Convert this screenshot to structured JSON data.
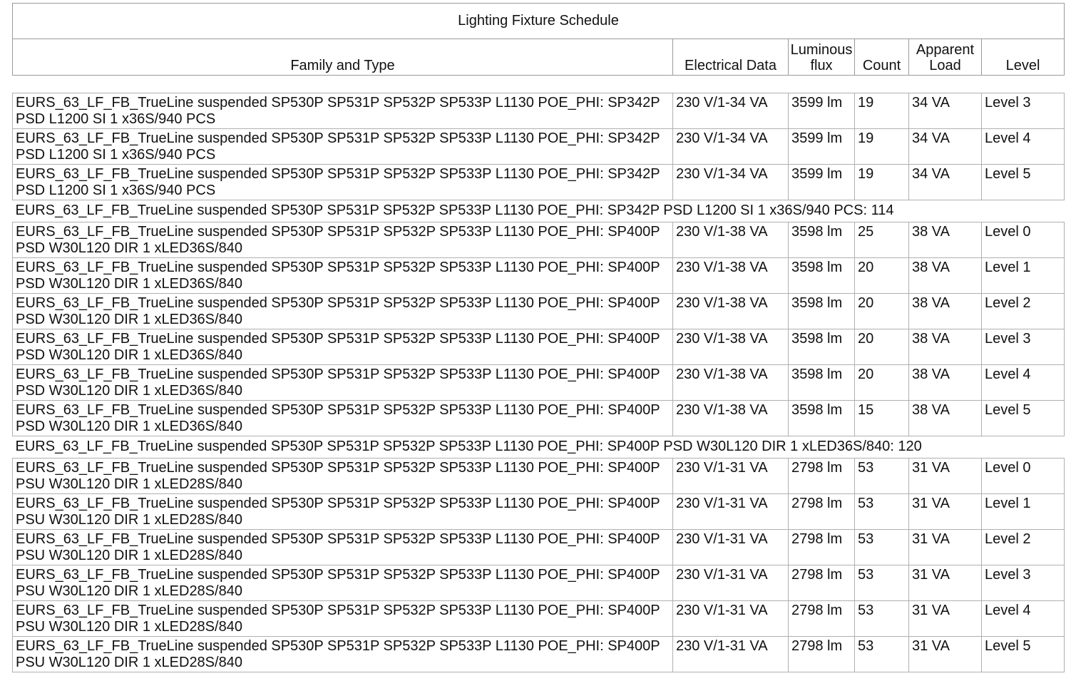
{
  "schedule": {
    "title": "Lighting Fixture Schedule",
    "columns": [
      "Family and Type",
      "Electrical Data",
      "Luminous flux",
      "Count",
      "Apparent Load",
      "Level"
    ],
    "groups": [
      {
        "rows": [
          {
            "family": "EURS_63_LF_FB_TrueLine suspended SP530P SP531P SP532P SP533P L1130 POE_PHI: SP342P PSD L1200 SI 1 x36S/940 PCS",
            "electrical": "230 V/1-34 VA",
            "flux": "3599 lm",
            "count": "19",
            "load": "34 VA",
            "level": "Level 3"
          },
          {
            "family": "EURS_63_LF_FB_TrueLine suspended SP530P SP531P SP532P SP533P L1130 POE_PHI: SP342P PSD L1200 SI 1 x36S/940 PCS",
            "electrical": "230 V/1-34 VA",
            "flux": "3599 lm",
            "count": "19",
            "load": "34 VA",
            "level": "Level 4"
          },
          {
            "family": "EURS_63_LF_FB_TrueLine suspended SP530P SP531P SP532P SP533P L1130 POE_PHI: SP342P PSD L1200 SI 1 x36S/940 PCS",
            "electrical": "230 V/1-34 VA",
            "flux": "3599 lm",
            "count": "19",
            "load": "34 VA",
            "level": "Level 5"
          }
        ],
        "subtotal": "EURS_63_LF_FB_TrueLine suspended SP530P SP531P SP532P SP533P L1130 POE_PHI: SP342P PSD L1200 SI 1 x36S/940 PCS: 114"
      },
      {
        "rows": [
          {
            "family": "EURS_63_LF_FB_TrueLine suspended SP530P SP531P SP532P SP533P L1130 POE_PHI: SP400P PSD W30L120 DIR 1 xLED36S/840",
            "electrical": "230 V/1-38 VA",
            "flux": "3598 lm",
            "count": "25",
            "load": "38 VA",
            "level": "Level 0"
          },
          {
            "family": "EURS_63_LF_FB_TrueLine suspended SP530P SP531P SP532P SP533P L1130 POE_PHI: SP400P PSD W30L120 DIR 1 xLED36S/840",
            "electrical": "230 V/1-38 VA",
            "flux": "3598 lm",
            "count": "20",
            "load": "38 VA",
            "level": "Level 1"
          },
          {
            "family": "EURS_63_LF_FB_TrueLine suspended SP530P SP531P SP532P SP533P L1130 POE_PHI: SP400P PSD W30L120 DIR 1 xLED36S/840",
            "electrical": "230 V/1-38 VA",
            "flux": "3598 lm",
            "count": "20",
            "load": "38 VA",
            "level": "Level 2"
          },
          {
            "family": "EURS_63_LF_FB_TrueLine suspended SP530P SP531P SP532P SP533P L1130 POE_PHI: SP400P PSD W30L120 DIR 1 xLED36S/840",
            "electrical": "230 V/1-38 VA",
            "flux": "3598 lm",
            "count": "20",
            "load": "38 VA",
            "level": "Level 3"
          },
          {
            "family": "EURS_63_LF_FB_TrueLine suspended SP530P SP531P SP532P SP533P L1130 POE_PHI: SP400P PSD W30L120 DIR 1 xLED36S/840",
            "electrical": "230 V/1-38 VA",
            "flux": "3598 lm",
            "count": "20",
            "load": "38 VA",
            "level": "Level 4"
          },
          {
            "family": "EURS_63_LF_FB_TrueLine suspended SP530P SP531P SP532P SP533P L1130 POE_PHI: SP400P PSD W30L120 DIR 1 xLED36S/840",
            "electrical": "230 V/1-38 VA",
            "flux": "3598 lm",
            "count": "15",
            "load": "38 VA",
            "level": "Level 5"
          }
        ],
        "subtotal": "EURS_63_LF_FB_TrueLine suspended SP530P SP531P SP532P SP533P L1130 POE_PHI: SP400P PSD W30L120 DIR 1 xLED36S/840: 120"
      },
      {
        "rows": [
          {
            "family": "EURS_63_LF_FB_TrueLine suspended SP530P SP531P SP532P SP533P L1130 POE_PHI: SP400P PSU W30L120 DIR 1 xLED28S/840",
            "electrical": "230 V/1-31 VA",
            "flux": "2798 lm",
            "count": "53",
            "load": "31 VA",
            "level": "Level 0"
          },
          {
            "family": "EURS_63_LF_FB_TrueLine suspended SP530P SP531P SP532P SP533P L1130 POE_PHI: SP400P PSU W30L120 DIR 1 xLED28S/840",
            "electrical": "230 V/1-31 VA",
            "flux": "2798 lm",
            "count": "53",
            "load": "31 VA",
            "level": "Level 1"
          },
          {
            "family": "EURS_63_LF_FB_TrueLine suspended SP530P SP531P SP532P SP533P L1130 POE_PHI: SP400P PSU W30L120 DIR 1 xLED28S/840",
            "electrical": "230 V/1-31 VA",
            "flux": "2798 lm",
            "count": "53",
            "load": "31 VA",
            "level": "Level 2"
          },
          {
            "family": "EURS_63_LF_FB_TrueLine suspended SP530P SP531P SP532P SP533P L1130 POE_PHI: SP400P PSU W30L120 DIR 1 xLED28S/840",
            "electrical": "230 V/1-31 VA",
            "flux": "2798 lm",
            "count": "53",
            "load": "31 VA",
            "level": "Level 3"
          },
          {
            "family": "EURS_63_LF_FB_TrueLine suspended SP530P SP531P SP532P SP533P L1130 POE_PHI: SP400P PSU W30L120 DIR 1 xLED28S/840",
            "electrical": "230 V/1-31 VA",
            "flux": "2798 lm",
            "count": "53",
            "load": "31 VA",
            "level": "Level 4"
          },
          {
            "family": "EURS_63_LF_FB_TrueLine suspended SP530P SP531P SP532P SP533P L1130 POE_PHI: SP400P PSU W30L120 DIR 1 xLED28S/840",
            "electrical": "230 V/1-31 VA",
            "flux": "2798 lm",
            "count": "53",
            "load": "31 VA",
            "level": "Level 5"
          }
        ],
        "subtotal": ""
      }
    ]
  }
}
